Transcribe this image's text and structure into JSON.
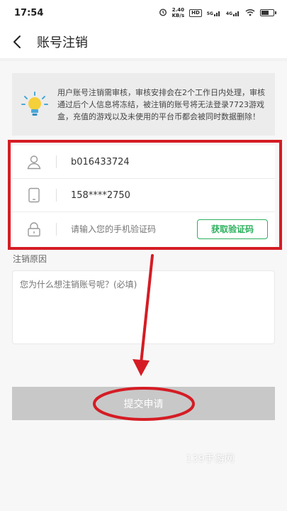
{
  "status_bar": {
    "time": "17:54",
    "net_rate_value": "2.40",
    "net_rate_unit": "KB/s",
    "hd_badge": "HD",
    "signal_1": "5G",
    "signal_2": "4G",
    "battery_level_percent": 60
  },
  "nav": {
    "title": "账号注销",
    "back_icon": "chevron-left-icon"
  },
  "notice": {
    "icon": "lightbulb-icon",
    "text": "用户账号注销需审核，审核安排会在2个工作日内处理，审核通过后个人信息将冻结，被注销的账号将无法登录7723游戏盒，充值的游戏以及未使用的平台币都会被同时数据删除！"
  },
  "form": {
    "account": {
      "icon": "user-icon",
      "value": "b016433724"
    },
    "phone": {
      "icon": "phone-icon",
      "value": "158****2750"
    },
    "code": {
      "icon": "lock-icon",
      "placeholder": "请输入您的手机验证码",
      "button_label": "获取验证码"
    }
  },
  "reason": {
    "label": "注销原因",
    "placeholder": "您为什么想注销账号呢？(必填)"
  },
  "submit": {
    "label": "提交申请"
  },
  "watermark": "139手游网",
  "colors": {
    "accent_green": "#2bb05c",
    "annotation_red": "#d51c24",
    "submit_disabled": "#c8c8c8"
  }
}
